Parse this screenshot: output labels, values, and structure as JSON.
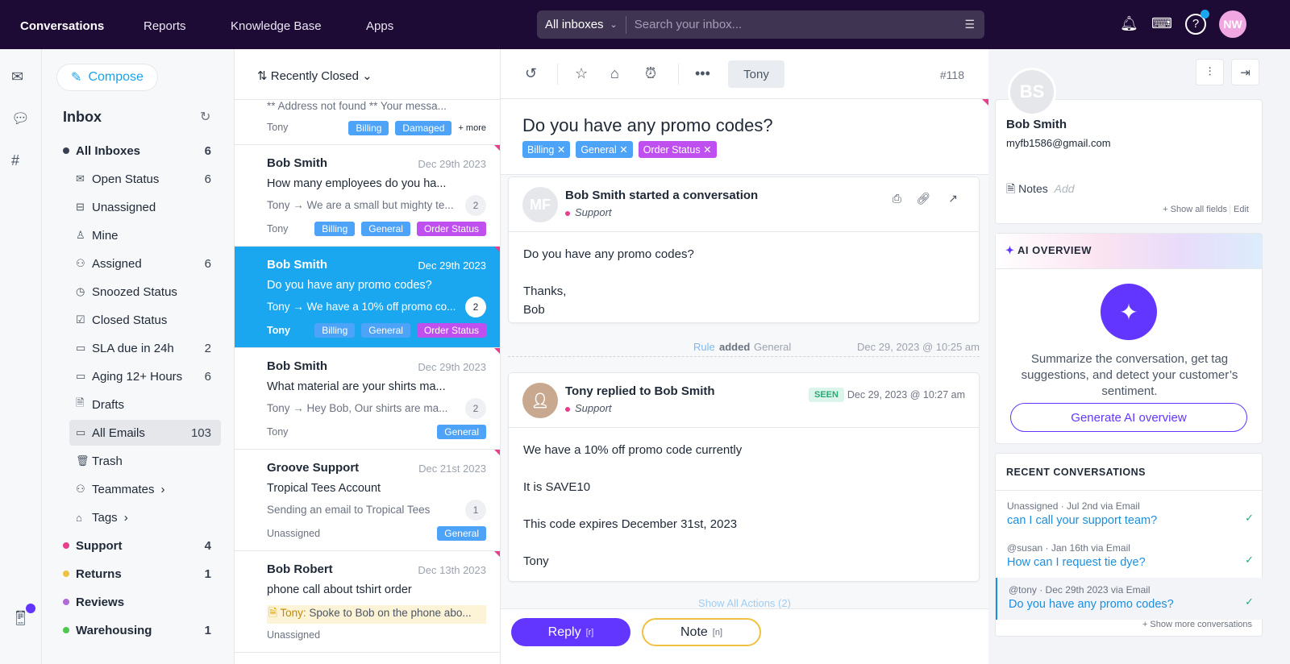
{
  "topnav": {
    "items": [
      "Conversations",
      "Reports",
      "Knowledge Base",
      "Apps"
    ],
    "inbox_select": "All inboxes",
    "search_placeholder": "Search your inbox...",
    "avatar": "NW"
  },
  "sidebar": {
    "compose": "Compose",
    "title": "Inbox",
    "items": [
      {
        "label": "All Inboxes",
        "count": "6"
      },
      {
        "label": "Open Status",
        "count": "6"
      },
      {
        "label": "Unassigned",
        "count": ""
      },
      {
        "label": "Mine",
        "count": ""
      },
      {
        "label": "Assigned",
        "count": "6"
      },
      {
        "label": "Snoozed Status",
        "count": ""
      },
      {
        "label": "Closed Status",
        "count": ""
      },
      {
        "label": "SLA due in 24h",
        "count": "2"
      },
      {
        "label": "Aging 12+ Hours",
        "count": "6"
      },
      {
        "label": "Drafts",
        "count": ""
      },
      {
        "label": "All Emails",
        "count": "103"
      },
      {
        "label": "Trash",
        "count": ""
      },
      {
        "label": "Teammates",
        "count": ""
      },
      {
        "label": "Tags",
        "count": ""
      },
      {
        "label": "Support",
        "count": "4",
        "color": "#e83e8c"
      },
      {
        "label": "Returns",
        "count": "1",
        "color": "#f0c040"
      },
      {
        "label": "Reviews",
        "count": "",
        "color": "#b06ad8"
      },
      {
        "label": "Warehousing",
        "count": "1",
        "color": "#4cc84c"
      }
    ]
  },
  "list": {
    "sort": "Recently Closed",
    "partial": {
      "preview": "** Address not found ** Your messa...",
      "agent": "Tony",
      "tags": [
        "Billing",
        "Damaged"
      ],
      "more": "+ more"
    },
    "cards": [
      {
        "name": "Bob Smith",
        "date": "Dec 29th 2023",
        "subject": "How many employees do you ha...",
        "preview": "Tony → We are a small but mighty te...",
        "count": "2",
        "agent": "Tony",
        "tags": [
          "Billing",
          "General",
          "Order Status"
        ]
      },
      {
        "name": "Bob Smith",
        "date": "Dec 29th 2023",
        "subject": "Do you have any promo codes?",
        "preview": "Tony → We have a 10% off promo co...",
        "count": "2",
        "agent": "Tony",
        "tags": [
          "Billing",
          "General",
          "Order Status"
        ]
      },
      {
        "name": "Bob Smith",
        "date": "Dec 29th 2023",
        "subject": "What material are your shirts ma...",
        "preview": "Tony → Hey Bob,   Our shirts are ma...",
        "count": "2",
        "agent": "Tony",
        "tags": [
          "General"
        ]
      },
      {
        "name": "Groove Support",
        "date": "Dec 21st 2023",
        "subject": "Tropical Tees Account",
        "preview": "Sending an email to Tropical Tees",
        "count": "1",
        "agent": "Unassigned",
        "tags": [
          "General"
        ]
      },
      {
        "name": "Bob Robert",
        "date": "Dec 13th 2023",
        "subject": "phone call about tshirt order",
        "note_author": "Tony:",
        "preview": "Spoke to Bob on the phone abo...",
        "agent": "Unassigned",
        "tags": []
      }
    ]
  },
  "conversation": {
    "assignee": "Tony",
    "number": "#118",
    "title": "Do you have any promo codes?",
    "tags": [
      "Billing",
      "General",
      "Order Status"
    ],
    "msg1": {
      "initials": "MF",
      "title": "Bob Smith started a conversation",
      "channel": "Support",
      "lines": [
        "Do you have any promo codes?",
        "Thanks,",
        "Bob"
      ]
    },
    "rule": {
      "a": "Rule",
      "b": "added",
      "c": "General",
      "date": "Dec 29, 2023 @ 10:25 am"
    },
    "msg2": {
      "title": "Tony replied to Bob Smith",
      "channel": "Support",
      "seen": "SEEN",
      "date": "Dec 29, 2023 @ 10:27 am",
      "lines": [
        "We have a 10% off promo code currently",
        "It is SAVE10",
        "This code expires December 31st, 2023",
        "Tony"
      ]
    },
    "show_actions": "Show All Actions (2)",
    "reply": "Reply",
    "reply_key": "[r]",
    "note": "Note",
    "note_key": "[n]"
  },
  "contact": {
    "initials": "BS",
    "name": "Bob Smith",
    "email": "myfb1586@gmail.com",
    "notes": "Notes",
    "add": "Add",
    "show_fields": "+ Show all fields",
    "edit": "Edit"
  },
  "ai": {
    "title": "AI OVERVIEW",
    "text": "Summarize the conversation, get tag suggestions, and detect your customer’s sentiment.",
    "button": "Generate AI overview"
  },
  "recent": {
    "title": "RECENT CONVERSATIONS",
    "items": [
      {
        "meta": "Unassigned · Jul 2nd via Email",
        "subject": "can I call your support team?"
      },
      {
        "meta": "@susan · Jan 16th via Email",
        "subject": "How can I request tie dye?"
      },
      {
        "meta": "@tony · Dec 29th 2023 via Email",
        "subject": "Do you have any promo codes?"
      }
    ],
    "more": "+ Show more conversations"
  }
}
